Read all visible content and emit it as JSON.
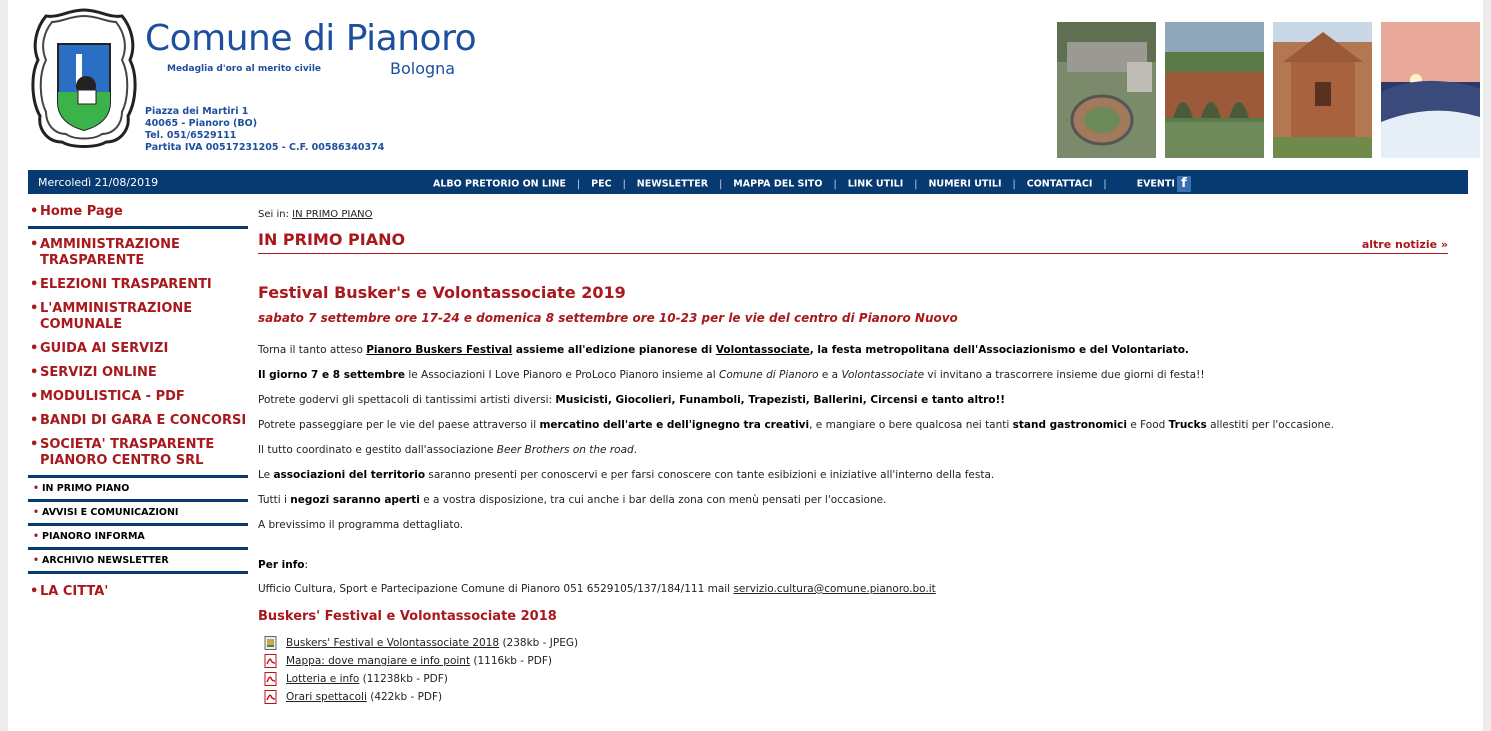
{
  "header": {
    "title": "Comune di Pianoro",
    "motto": "Medaglia d'oro al merito civile",
    "province": "Bologna",
    "address_lines": [
      "Piazza dei Martiri 1",
      "40065 - Pianoro (BO)",
      "Tel. 051/6529111",
      "Partita IVA 00517231205 - C.F. 00586340374"
    ]
  },
  "navbar": {
    "date": "Mercoledì 21/08/2019",
    "links": [
      "ALBO PRETORIO ON LINE",
      "PEC",
      "NEWSLETTER",
      "MAPPA DEL SITO",
      "LINK UTILI",
      "NUMERI UTILI",
      "CONTATTACI",
      "EVENTI"
    ],
    "facebook_glyph": "f"
  },
  "sidebar": {
    "bullet": "•",
    "home": "Home Page",
    "items": [
      "AMMINISTRAZIONE TRASPARENTE",
      "ELEZIONI TRASPARENTI",
      "L'AMMINISTRAZIONE COMUNALE",
      "GUIDA AI SERVIZI",
      "SERVIZI ONLINE",
      "MODULISTICA - PDF",
      "BANDI DI GARA E CONCORSI",
      "SOCIETA' TRASPARENTE PIANORO CENTRO SRL"
    ],
    "subitems": [
      "IN PRIMO PIANO",
      "AVVISI E COMUNICAZIONI",
      "PIANORO INFORMA",
      "ARCHIVIO NEWSLETTER"
    ],
    "last": "LA CITTA'"
  },
  "main": {
    "breadcrumb_prefix": "Sei in:",
    "breadcrumb_link": "IN PRIMO PIANO",
    "section_title": "IN PRIMO PIANO",
    "more_link": "altre notizie »",
    "article_title": "Festival Busker's e Volontassociate 2019",
    "article_subtitle": "sabato 7 settembre ore 17-24 e domenica 8 settembre ore 10-23 per le vie del centro di Pianoro Nuovo",
    "p1": {
      "a": "Torna il tanto atteso ",
      "b": "Pianoro Buskers Festival",
      "c": " assieme all'edizione pianorese di ",
      "d": "Volontassociate",
      "e": ", la festa metropolitana dell'Associazionismo e del Volontariato."
    },
    "p2": {
      "a": "Il giorno 7 e 8  settembre",
      "b": " le Associazioni I Love Pianoro e ProLoco Pianoro insieme al ",
      "c": "Comune di Pianoro",
      "d": " e a ",
      "e": "Volontassociate",
      "f": " vi invitano a trascorrere insieme due giorni di festa!!"
    },
    "p3": {
      "a": "Potrete godervi gli spettacoli di tantissimi artisti diversi:  ",
      "b": "Musicisti, Giocolieri, Funamboli, Trapezisti, Ballerini, Circensi e tanto altro!!"
    },
    "p4": {
      "a": "Potrete passeggiare per le vie del paese attraverso il ",
      "b": "mercatino dell'arte e dell'ignegno tra creativi",
      "c": ", e mangiare o bere qualcosa nei tanti ",
      "d": "stand gastronomici",
      "e": " e Food ",
      "f": "Trucks",
      "g": " allestiti per l'occasione."
    },
    "p5": {
      "a": "Il tutto coordinato e gestito dall'associazione ",
      "b": "Beer Brothers on the road",
      "c": "."
    },
    "p6": {
      "a": "Le ",
      "b": "associazioni del territorio",
      "c": " saranno presenti per conoscervi e per farsi conoscere con tante esibizioni e iniziative all'interno della festa."
    },
    "p7": {
      "a": "Tutti i ",
      "b": "negozi saranno aperti",
      "c": " e a vostra disposizione, tra cui anche i bar della zona con menù pensati per l'occasione."
    },
    "p8": "A brevissimo il programma dettagliato.",
    "info_label": "Per info",
    "info_colon": ":",
    "info_text": "Ufficio Cultura, Sport e Partecipazione Comune di Pianoro 051 6529105/137/184/111 mail ",
    "info_email": "servizio.cultura@comune.pianoro.bo.it",
    "attachments_title": "Buskers' Festival e Volontassociate 2018",
    "attachments": [
      {
        "name": "Buskers' Festival e Volontassociate 2018",
        "meta": " (238kb - JPEG)",
        "type": "jpeg"
      },
      {
        "name": "Mappa: dove mangiare e info point",
        "meta": " (1116kb - PDF)",
        "type": "pdf"
      },
      {
        "name": "Lotteria e info",
        "meta": " (11238kb - PDF)",
        "type": "pdf"
      },
      {
        "name": "Orari spettacoli",
        "meta": " (422kb - PDF)",
        "type": "pdf"
      }
    ]
  },
  "colors": {
    "brand_red": "#a8181c",
    "nav_blue": "#073a71",
    "title_blue": "#1d4f9e"
  }
}
